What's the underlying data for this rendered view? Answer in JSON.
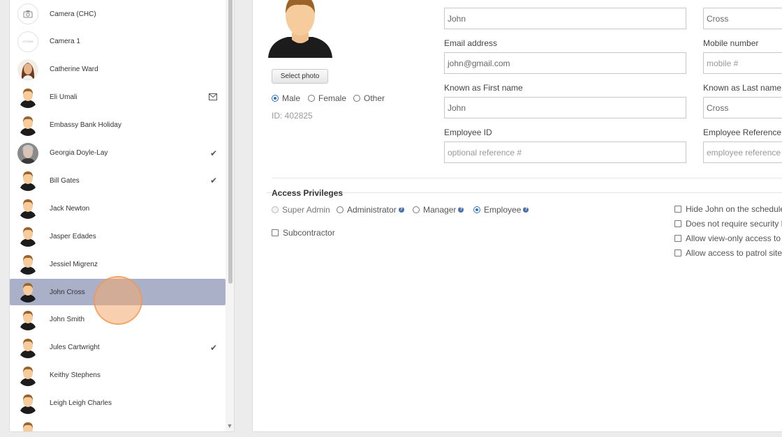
{
  "employees": [
    {
      "name": "Camera (CHC)",
      "avatar": "camera-icon",
      "mark": ""
    },
    {
      "name": "Camera 1",
      "avatar": "other-badge",
      "badge_text": "OTHER",
      "mark": ""
    },
    {
      "name": "Catherine Ward",
      "avatar": "photo-woman",
      "mark": ""
    },
    {
      "name": "Eli Umali",
      "avatar": "default-person",
      "mark": "envelope-icon"
    },
    {
      "name": "Embassy Bank Holiday",
      "avatar": "default-person",
      "mark": ""
    },
    {
      "name": "Georgia Doyle-Lay",
      "avatar": "photo-gray",
      "mark": "check-icon"
    },
    {
      "name": "Bill Gates",
      "avatar": "default-person",
      "mark": "check-icon"
    },
    {
      "name": "Jack Newton",
      "avatar": "default-person",
      "mark": ""
    },
    {
      "name": "Jasper Edades",
      "avatar": "default-person",
      "mark": ""
    },
    {
      "name": "Jessiel Migrenz",
      "avatar": "default-person",
      "mark": ""
    },
    {
      "name": "John Cross",
      "avatar": "default-person",
      "mark": "",
      "selected": true
    },
    {
      "name": "John Smith",
      "avatar": "default-person",
      "mark": ""
    },
    {
      "name": "Jules Cartwright",
      "avatar": "default-person",
      "mark": "check-icon"
    },
    {
      "name": "Keithy Stephens",
      "avatar": "default-person",
      "mark": ""
    },
    {
      "name": "Leigh Leigh Charles",
      "avatar": "default-person",
      "mark": ""
    },
    {
      "name": "",
      "avatar": "default-person",
      "mark": ""
    }
  ],
  "profile": {
    "select_photo_label": "Select photo",
    "gender_options": [
      "Male",
      "Female",
      "Other"
    ],
    "gender_selected": "Male",
    "id_text": "ID: 402825"
  },
  "form": {
    "first_name_value": "John",
    "last_name_value": "Cross",
    "email_label": "Email address",
    "email_value": "john@gmail.com",
    "mobile_label": "Mobile number",
    "mobile_placeholder": "mobile #",
    "known_first_label": "Known as First name",
    "known_first_value": "John",
    "known_last_label": "Known as Last name",
    "known_last_value": "Cross",
    "employee_id_label": "Employee ID",
    "employee_id_placeholder": "optional reference #",
    "employee_ref_label": "Employee Reference N",
    "employee_ref_placeholder": "employee reference #"
  },
  "access": {
    "title": "Access Privileges",
    "roles": [
      {
        "label": "Super Admin",
        "help": false,
        "state": "disabled"
      },
      {
        "label": "Administrator",
        "help": true,
        "state": "off"
      },
      {
        "label": "Manager",
        "help": true,
        "state": "off"
      },
      {
        "label": "Employee",
        "help": true,
        "state": "on"
      }
    ],
    "help_glyph": "?",
    "subcontractor_label": "Subcontractor",
    "options": [
      "Hide John on the schedule",
      "Does not require security lic",
      "Allow view-only access to fi",
      "Allow access to patrol sites"
    ]
  },
  "colors": {
    "selected_row": "#a9b0c8",
    "radio_accent": "#2a6fc9",
    "click_indicator": "#f4aa6e"
  }
}
